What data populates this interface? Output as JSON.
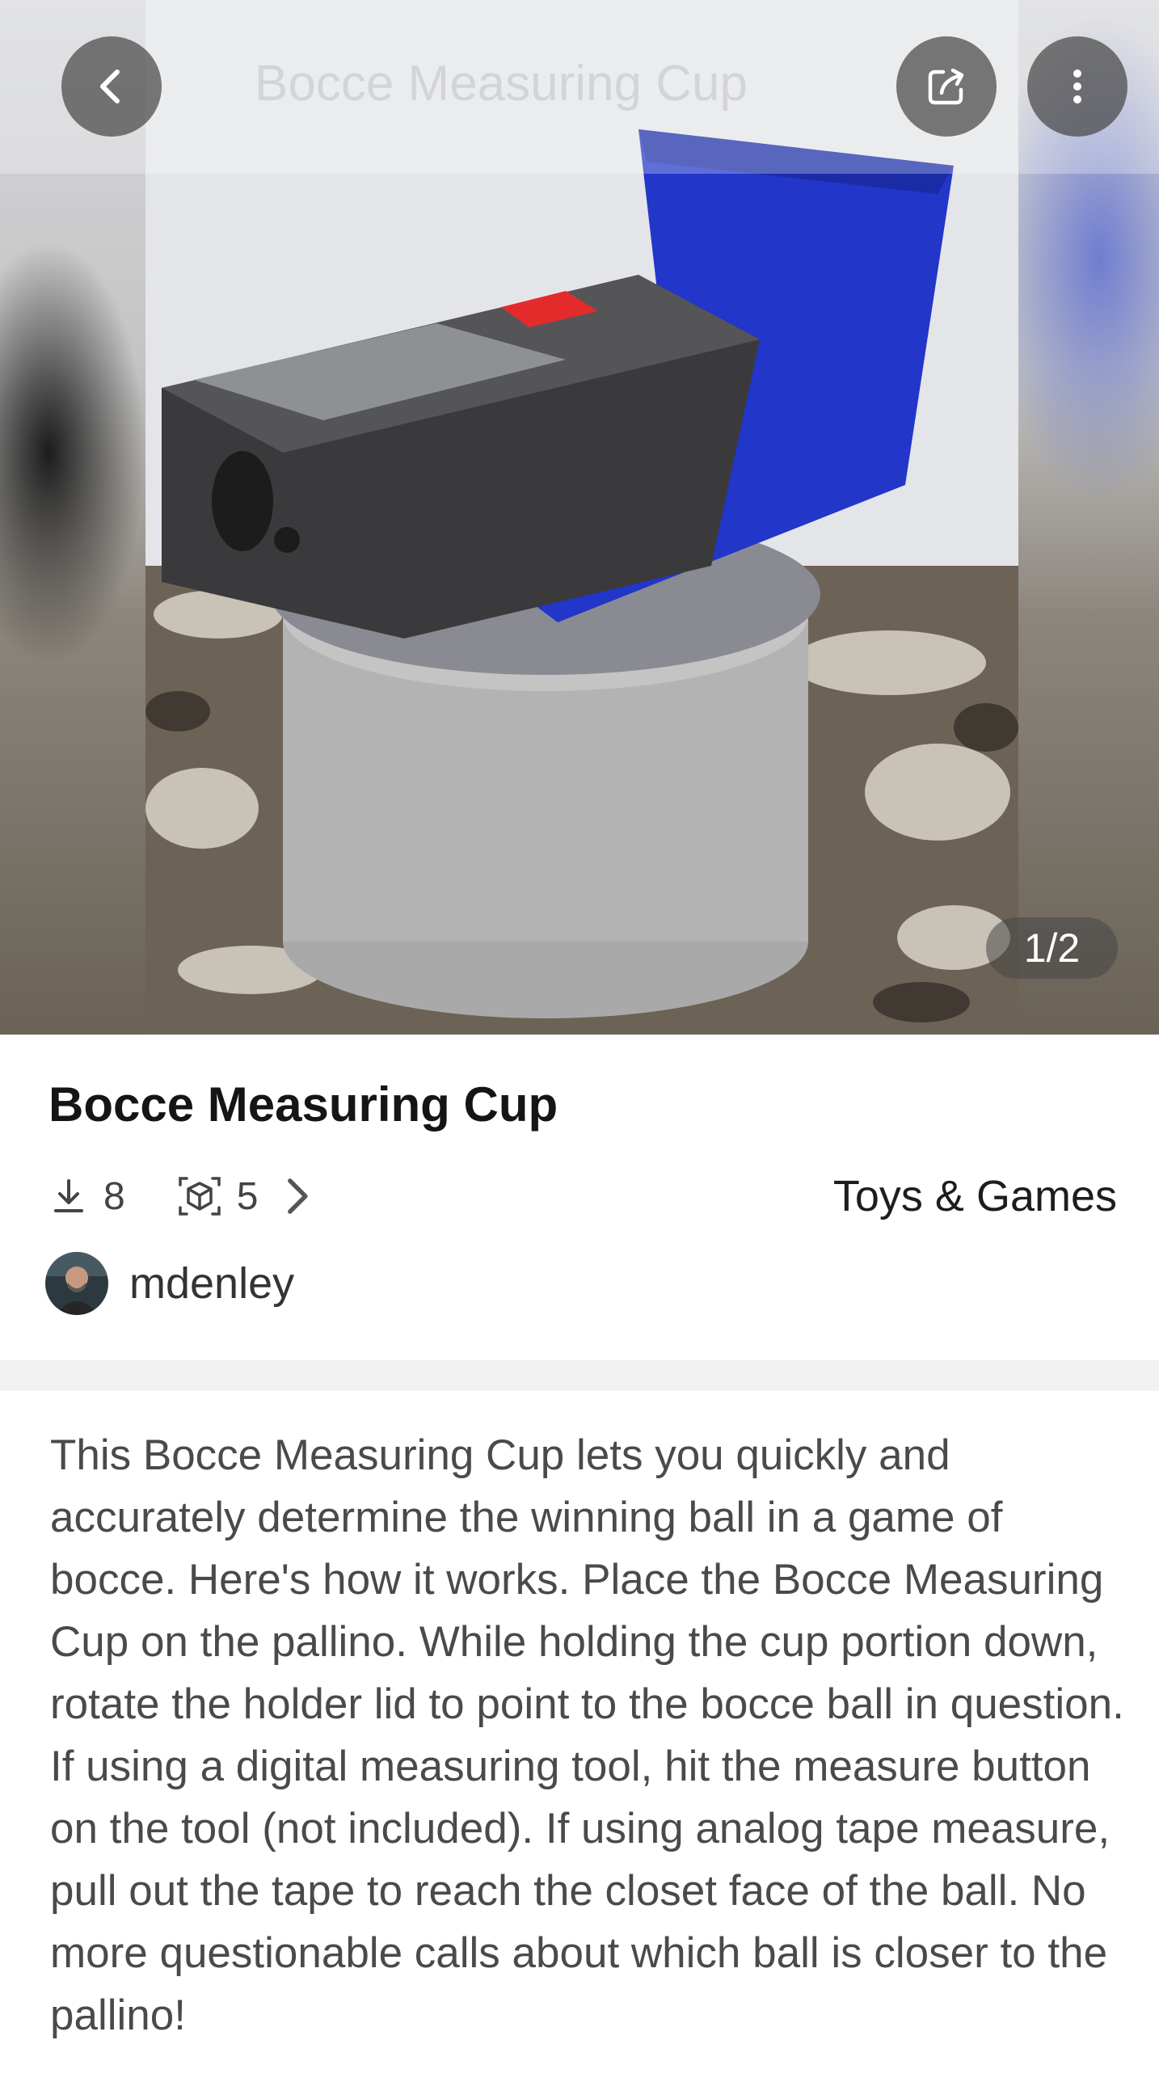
{
  "header": {
    "ghost_title": "Bocce Measuring Cup",
    "icons": {
      "back": "chevron-left-icon",
      "share": "share-icon",
      "more": "more-vertical-icon"
    }
  },
  "gallery": {
    "counter": "1/2"
  },
  "model": {
    "title": "Bocce Measuring Cup",
    "downloads": "8",
    "remixes": "5",
    "category": "Toys & Games",
    "author": "mdenley"
  },
  "description": "This Bocce Measuring Cup lets you quickly and accurately determine the winning ball in a game of bocce. Here's how it works. Place the Bocce Measuring Cup on the pallino. While holding the cup portion down, rotate the holder lid to point to the bocce ball in question. If using a digital measuring tool, hit the measure button on the tool (not included). If using analog tape measure, pull out the tape to reach the closet face of the ball. No more questionable calls about which ball is closer to the pallino!",
  "colors": {
    "title": "#151515",
    "text": "#4a4a4a",
    "divider": "#f1f1f1",
    "overlay_button": "#464646"
  }
}
